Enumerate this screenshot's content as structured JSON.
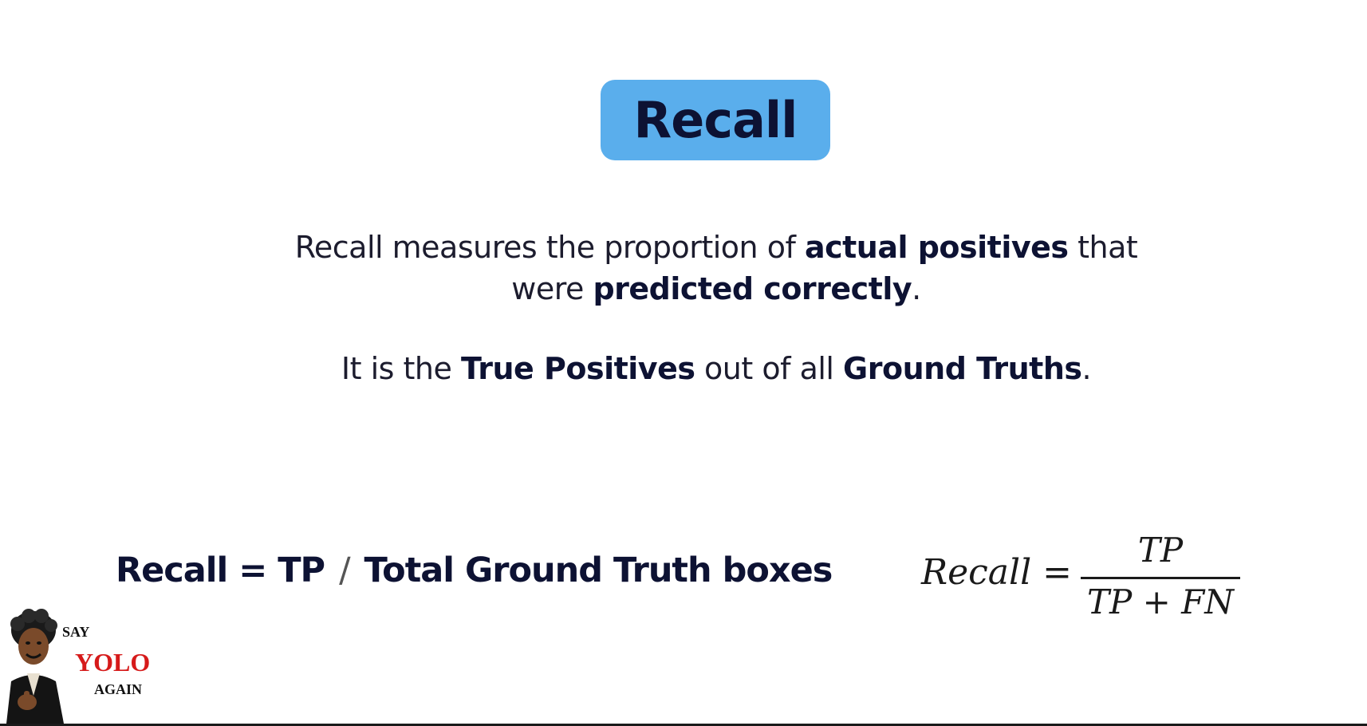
{
  "title": "Recall",
  "colors": {
    "pill_background": "#5aaeec",
    "text_dark": "#0d1233",
    "watermark_red": "#d61a1a"
  },
  "description": {
    "line1_part1": "Recall measures the proportion of ",
    "line1_bold": "actual positives",
    "line1_part2": " that",
    "line2_part1": "were ",
    "line2_bold": "predicted correctly",
    "line2_part2": "."
  },
  "description2": {
    "part1": "It is the ",
    "bold1": "True Positives",
    "part2": " out of all ",
    "bold2": "Ground Truths",
    "part3": "."
  },
  "formula_text": {
    "left": "Recall = TP",
    "slash": "/",
    "right": "Total Ground Truth boxes"
  },
  "formula_math": {
    "lhs": "Recall =",
    "numerator": "TP",
    "denominator": "TP + FN"
  },
  "watermark": {
    "say": "SAY",
    "yolo": "YOLO",
    "again": "AGAIN",
    "figure_icon": "pointing-man-illustration"
  }
}
